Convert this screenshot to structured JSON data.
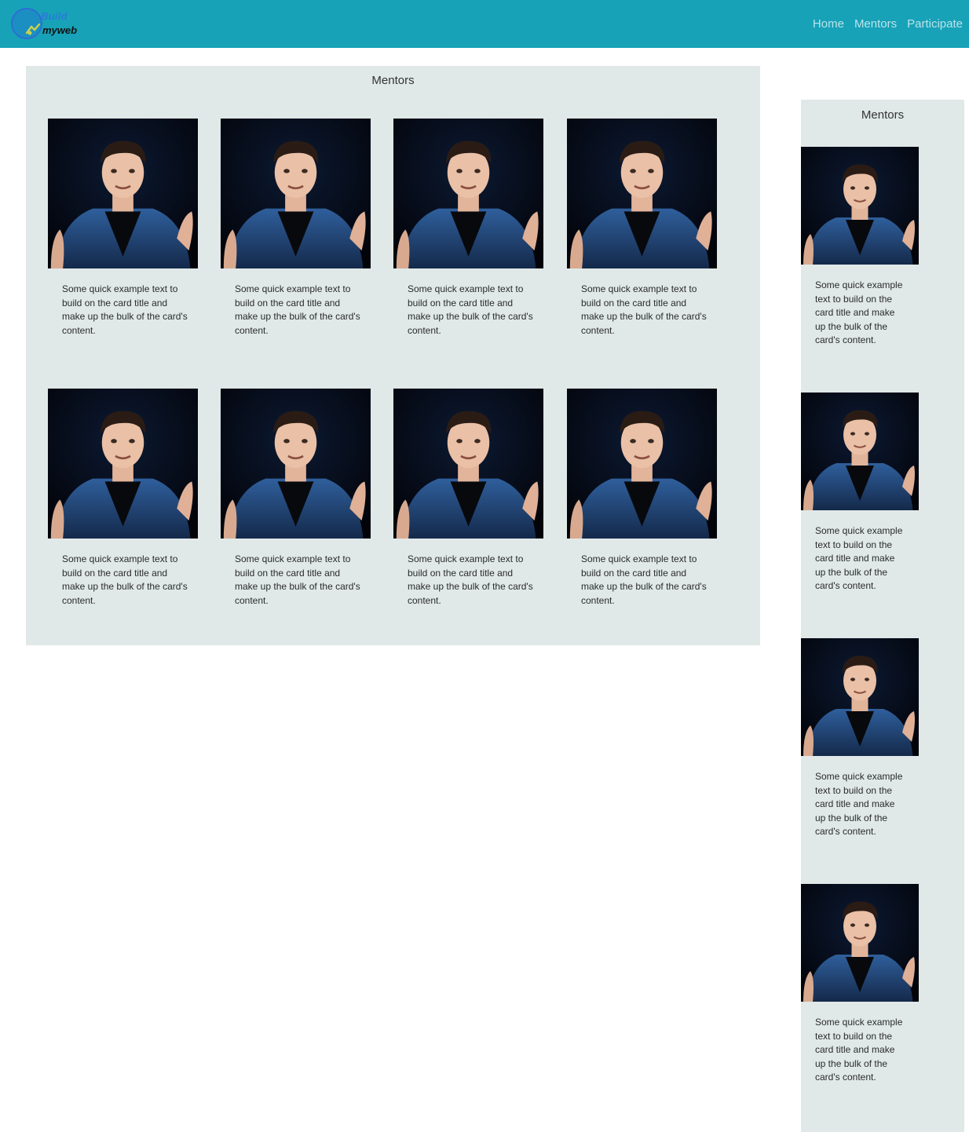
{
  "brand": {
    "line1": "Build",
    "line2": "myweb"
  },
  "nav": {
    "items": [
      "Home",
      "Mentors",
      "Participate"
    ]
  },
  "main": {
    "title": "Mentors",
    "cards": [
      {
        "image": "mentor-photo",
        "text": "Some quick example text to build on the card title and make up the bulk of the card's content."
      },
      {
        "image": "mentor-photo",
        "text": "Some quick example text to build on the card title and make up the bulk of the card's content."
      },
      {
        "image": "mentor-photo",
        "text": "Some quick example text to build on the card title and make up the bulk of the card's content."
      },
      {
        "image": "mentor-photo",
        "text": "Some quick example text to build on the card title and make up the bulk of the card's content."
      },
      {
        "image": "mentor-photo",
        "text": "Some quick example text to build on the card title and make up the bulk of the card's content."
      },
      {
        "image": "mentor-photo",
        "text": "Some quick example text to build on the card title and make up the bulk of the card's content."
      },
      {
        "image": "mentor-photo",
        "text": "Some quick example text to build on the card title and make up the bulk of the card's content."
      },
      {
        "image": "mentor-photo",
        "text": "Some quick example text to build on the card title and make up the bulk of the card's content."
      }
    ]
  },
  "side": {
    "title": "Mentors",
    "cards": [
      {
        "image": "mentor-photo",
        "text": "Some quick example text to build on the card title and make up the bulk of the card's content."
      },
      {
        "image": "mentor-photo",
        "text": "Some quick example text to build on the card title and make up the bulk of the card's content."
      },
      {
        "image": "mentor-photo",
        "text": "Some quick example text to build on the card title and make up the bulk of the card's content."
      },
      {
        "image": "mentor-photo",
        "text": "Some quick example text to build on the card title and make up the bulk of the card's content."
      }
    ]
  },
  "colors": {
    "navbar": "#17a2b8",
    "panel": "#e0e8e8",
    "nav_link": "rgba(255,255,255,0.7)"
  }
}
